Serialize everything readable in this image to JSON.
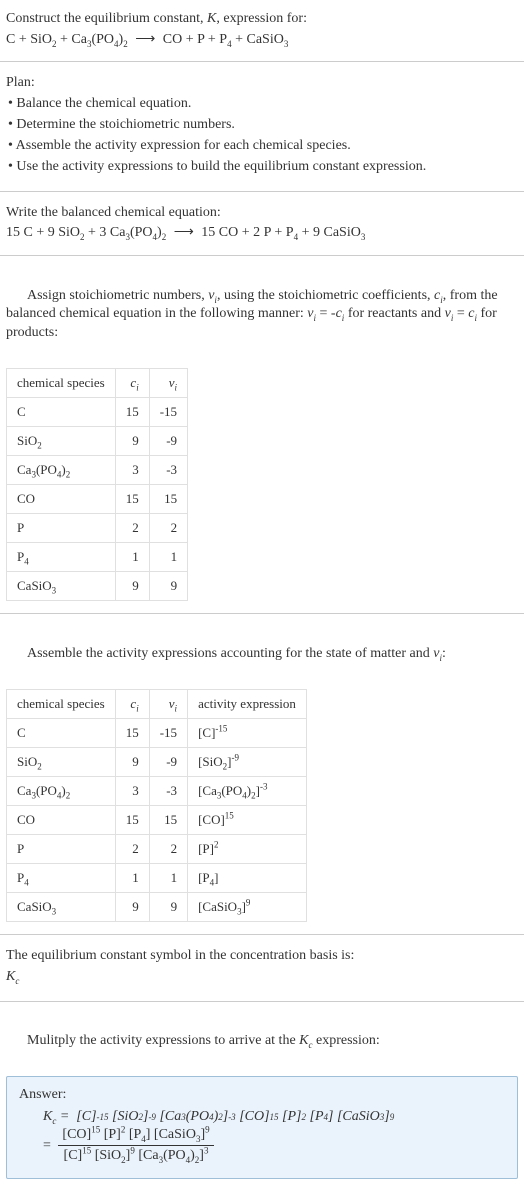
{
  "header": {
    "prompt": "Construct the equilibrium constant, K, expression for:"
  },
  "unbalanced": {
    "lhs": [
      {
        "coef": "",
        "species": [
          [
            "C",
            ""
          ]
        ]
      },
      {
        "coef": "",
        "species": [
          [
            "SiO",
            ""
          ],
          [
            "",
            "2"
          ]
        ]
      },
      {
        "coef": "",
        "species": [
          [
            "Ca",
            ""
          ],
          [
            "",
            "3"
          ],
          [
            "(PO",
            ""
          ],
          [
            "",
            "4"
          ],
          [
            ")",
            ""
          ],
          [
            "",
            "2"
          ]
        ]
      }
    ],
    "rhs": [
      {
        "coef": "",
        "species": [
          [
            "CO",
            ""
          ]
        ]
      },
      {
        "coef": "",
        "species": [
          [
            "P",
            ""
          ]
        ]
      },
      {
        "coef": "",
        "species": [
          [
            "P",
            ""
          ],
          [
            "",
            "4"
          ]
        ]
      },
      {
        "coef": "",
        "species": [
          [
            "CaSiO",
            ""
          ],
          [
            "",
            "3"
          ]
        ]
      }
    ],
    "arrow": "⟶"
  },
  "plan": {
    "title": "Plan:",
    "items": [
      "• Balance the chemical equation.",
      "• Determine the stoichiometric numbers.",
      "• Assemble the activity expression for each chemical species.",
      "• Use the activity expressions to build the equilibrium constant expression."
    ]
  },
  "balanced_title": "Write the balanced chemical equation:",
  "balanced": {
    "lhs": [
      {
        "coef": "15",
        "species": [
          [
            "C",
            ""
          ]
        ]
      },
      {
        "coef": "9",
        "species": [
          [
            "SiO",
            ""
          ],
          [
            "",
            "2"
          ]
        ]
      },
      {
        "coef": "3",
        "species": [
          [
            "Ca",
            ""
          ],
          [
            "",
            "3"
          ],
          [
            "(PO",
            ""
          ],
          [
            "",
            "4"
          ],
          [
            ")",
            ""
          ],
          [
            "",
            "2"
          ]
        ]
      }
    ],
    "rhs": [
      {
        "coef": "15",
        "species": [
          [
            "CO",
            ""
          ]
        ]
      },
      {
        "coef": "2",
        "species": [
          [
            "P",
            ""
          ]
        ]
      },
      {
        "coef": "",
        "species": [
          [
            "P",
            ""
          ],
          [
            "",
            "4"
          ]
        ]
      },
      {
        "coef": "9",
        "species": [
          [
            "CaSiO",
            ""
          ],
          [
            "",
            "3"
          ]
        ]
      }
    ],
    "arrow": "⟶"
  },
  "stoich_intro_a": "Assign stoichiometric numbers, νᵢ, using the stoichiometric coefficients, cᵢ, from the balanced chemical equation in the following manner: νᵢ = -cᵢ for reactants and νᵢ = cᵢ for products:",
  "table1": {
    "headers": [
      "chemical species",
      "cᵢ",
      "νᵢ"
    ],
    "rows": [
      {
        "species": "C",
        "ci": "15",
        "vi": "-15"
      },
      {
        "species": "SiO2",
        "ci": "9",
        "vi": "-9"
      },
      {
        "species": "Ca3(PO4)2",
        "ci": "3",
        "vi": "-3"
      },
      {
        "species": "CO",
        "ci": "15",
        "vi": "15"
      },
      {
        "species": "P",
        "ci": "2",
        "vi": "2"
      },
      {
        "species": "P4",
        "ci": "1",
        "vi": "1"
      },
      {
        "species": "CaSiO3",
        "ci": "9",
        "vi": "9"
      }
    ]
  },
  "activity_intro": "Assemble the activity expressions accounting for the state of matter and νᵢ:",
  "table2": {
    "headers": [
      "chemical species",
      "cᵢ",
      "νᵢ",
      "activity expression"
    ],
    "rows": [
      {
        "species": "C",
        "ci": "15",
        "vi": "-15",
        "act_base": "[C]",
        "act_exp": "-15"
      },
      {
        "species": "SiO2",
        "ci": "9",
        "vi": "-9",
        "act_base": "[SiO2]",
        "act_exp": "-9"
      },
      {
        "species": "Ca3(PO4)2",
        "ci": "3",
        "vi": "-3",
        "act_base": "[Ca3(PO4)2]",
        "act_exp": "-3"
      },
      {
        "species": "CO",
        "ci": "15",
        "vi": "15",
        "act_base": "[CO]",
        "act_exp": "15"
      },
      {
        "species": "P",
        "ci": "2",
        "vi": "2",
        "act_base": "[P]",
        "act_exp": "2"
      },
      {
        "species": "P4",
        "ci": "1",
        "vi": "1",
        "act_base": "[P4]",
        "act_exp": ""
      },
      {
        "species": "CaSiO3",
        "ci": "9",
        "vi": "9",
        "act_base": "[CaSiO3]",
        "act_exp": "9"
      }
    ]
  },
  "kc_symbol_a": "The equilibrium constant symbol in the concentration basis is:",
  "kc_symbol_b": "K_c",
  "multiply_line": "Mulitply the activity expressions to arrive at the K_c expression:",
  "answer": {
    "label": "Answer:",
    "line1_prefix": "K_c = ",
    "line1_terms": [
      {
        "base": "[C]",
        "exp": "-15"
      },
      {
        "base": "[SiO2]",
        "exp": "-9"
      },
      {
        "base": "[Ca3(PO4)2]",
        "exp": "-3"
      },
      {
        "base": "[CO]",
        "exp": "15"
      },
      {
        "base": "[P]",
        "exp": "2"
      },
      {
        "base": "[P4]",
        "exp": ""
      },
      {
        "base": "[CaSiO3]",
        "exp": "9"
      }
    ],
    "line2_prefix": " = ",
    "frac_num": [
      {
        "base": "[CO]",
        "exp": "15"
      },
      {
        "base": "[P]",
        "exp": "2"
      },
      {
        "base": "[P4]",
        "exp": ""
      },
      {
        "base": "[CaSiO3]",
        "exp": "9"
      }
    ],
    "frac_den": [
      {
        "base": "[C]",
        "exp": "15"
      },
      {
        "base": "[SiO2]",
        "exp": "9"
      },
      {
        "base": "[Ca3(PO4)2]",
        "exp": "3"
      }
    ]
  }
}
